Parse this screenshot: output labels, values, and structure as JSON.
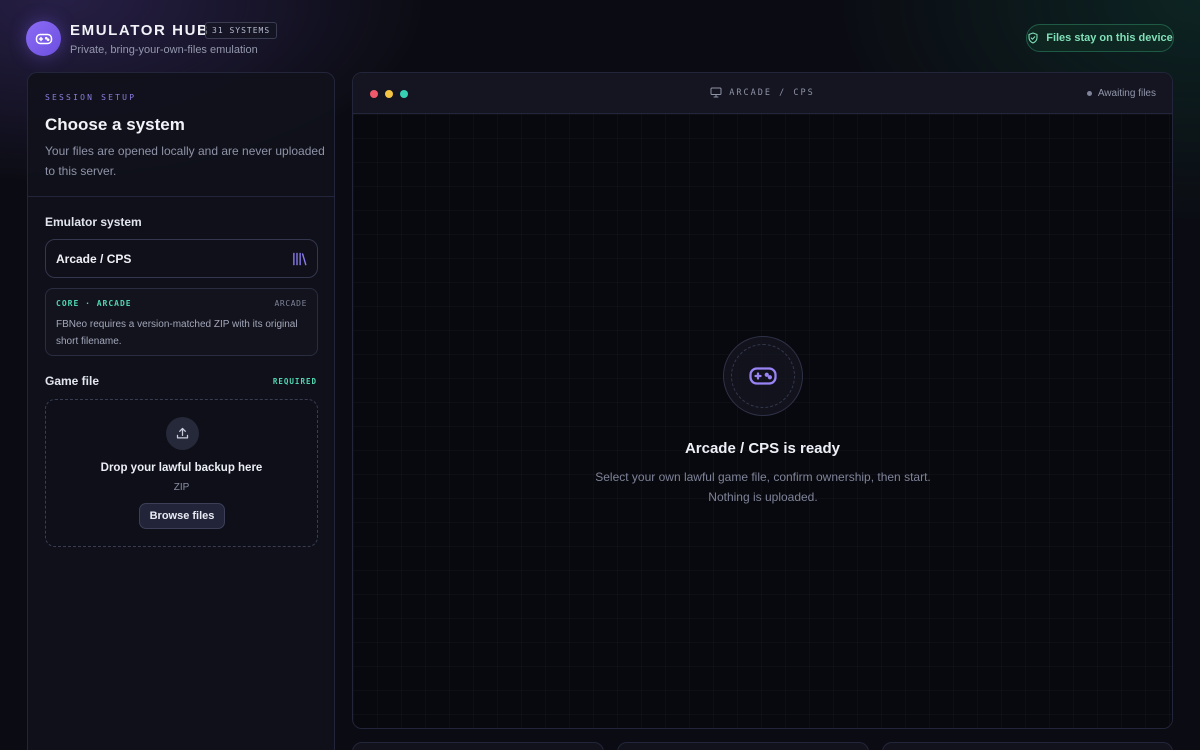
{
  "header": {
    "app_title": "EMULATOR HUB",
    "systems_badge": "31 SYSTEMS",
    "subtitle": "Private, bring-your-own-files emulation",
    "privacy_pill": "Files stay on this device",
    "logo_icon": "gamepad-icon"
  },
  "setup": {
    "eyebrow": "SESSION SETUP",
    "title": "Choose a system",
    "description": "Your files are opened locally and are never uploaded to this server.",
    "system_label": "Emulator system",
    "selected_system": "Arcade / CPS",
    "library_icon": "library-icon",
    "core": {
      "tag": "CORE · ARCADE",
      "kind": "ARCADE",
      "note": "FBNeo requires a version-matched ZIP with its original short filename."
    },
    "game_file_label": "Game file",
    "required_tag": "REQUIRED",
    "dropzone": {
      "title": "Drop your lawful backup here",
      "formats": "ZIP",
      "browse_label": "Browse files",
      "icon": "upload-icon"
    }
  },
  "stage": {
    "window_title": "ARCADE / CPS",
    "status": "Awaiting files",
    "ready_title": "Arcade / CPS is ready",
    "ready_desc": "Select your own lawful game file, confirm ownership, then start. Nothing is uploaded.",
    "window_dots": [
      "#f0596b",
      "#f4c443",
      "#36d0b5"
    ]
  },
  "colors": {
    "accent": "#8b6cf6",
    "teal": "#4fd6b0",
    "background": "#0b0c13"
  }
}
